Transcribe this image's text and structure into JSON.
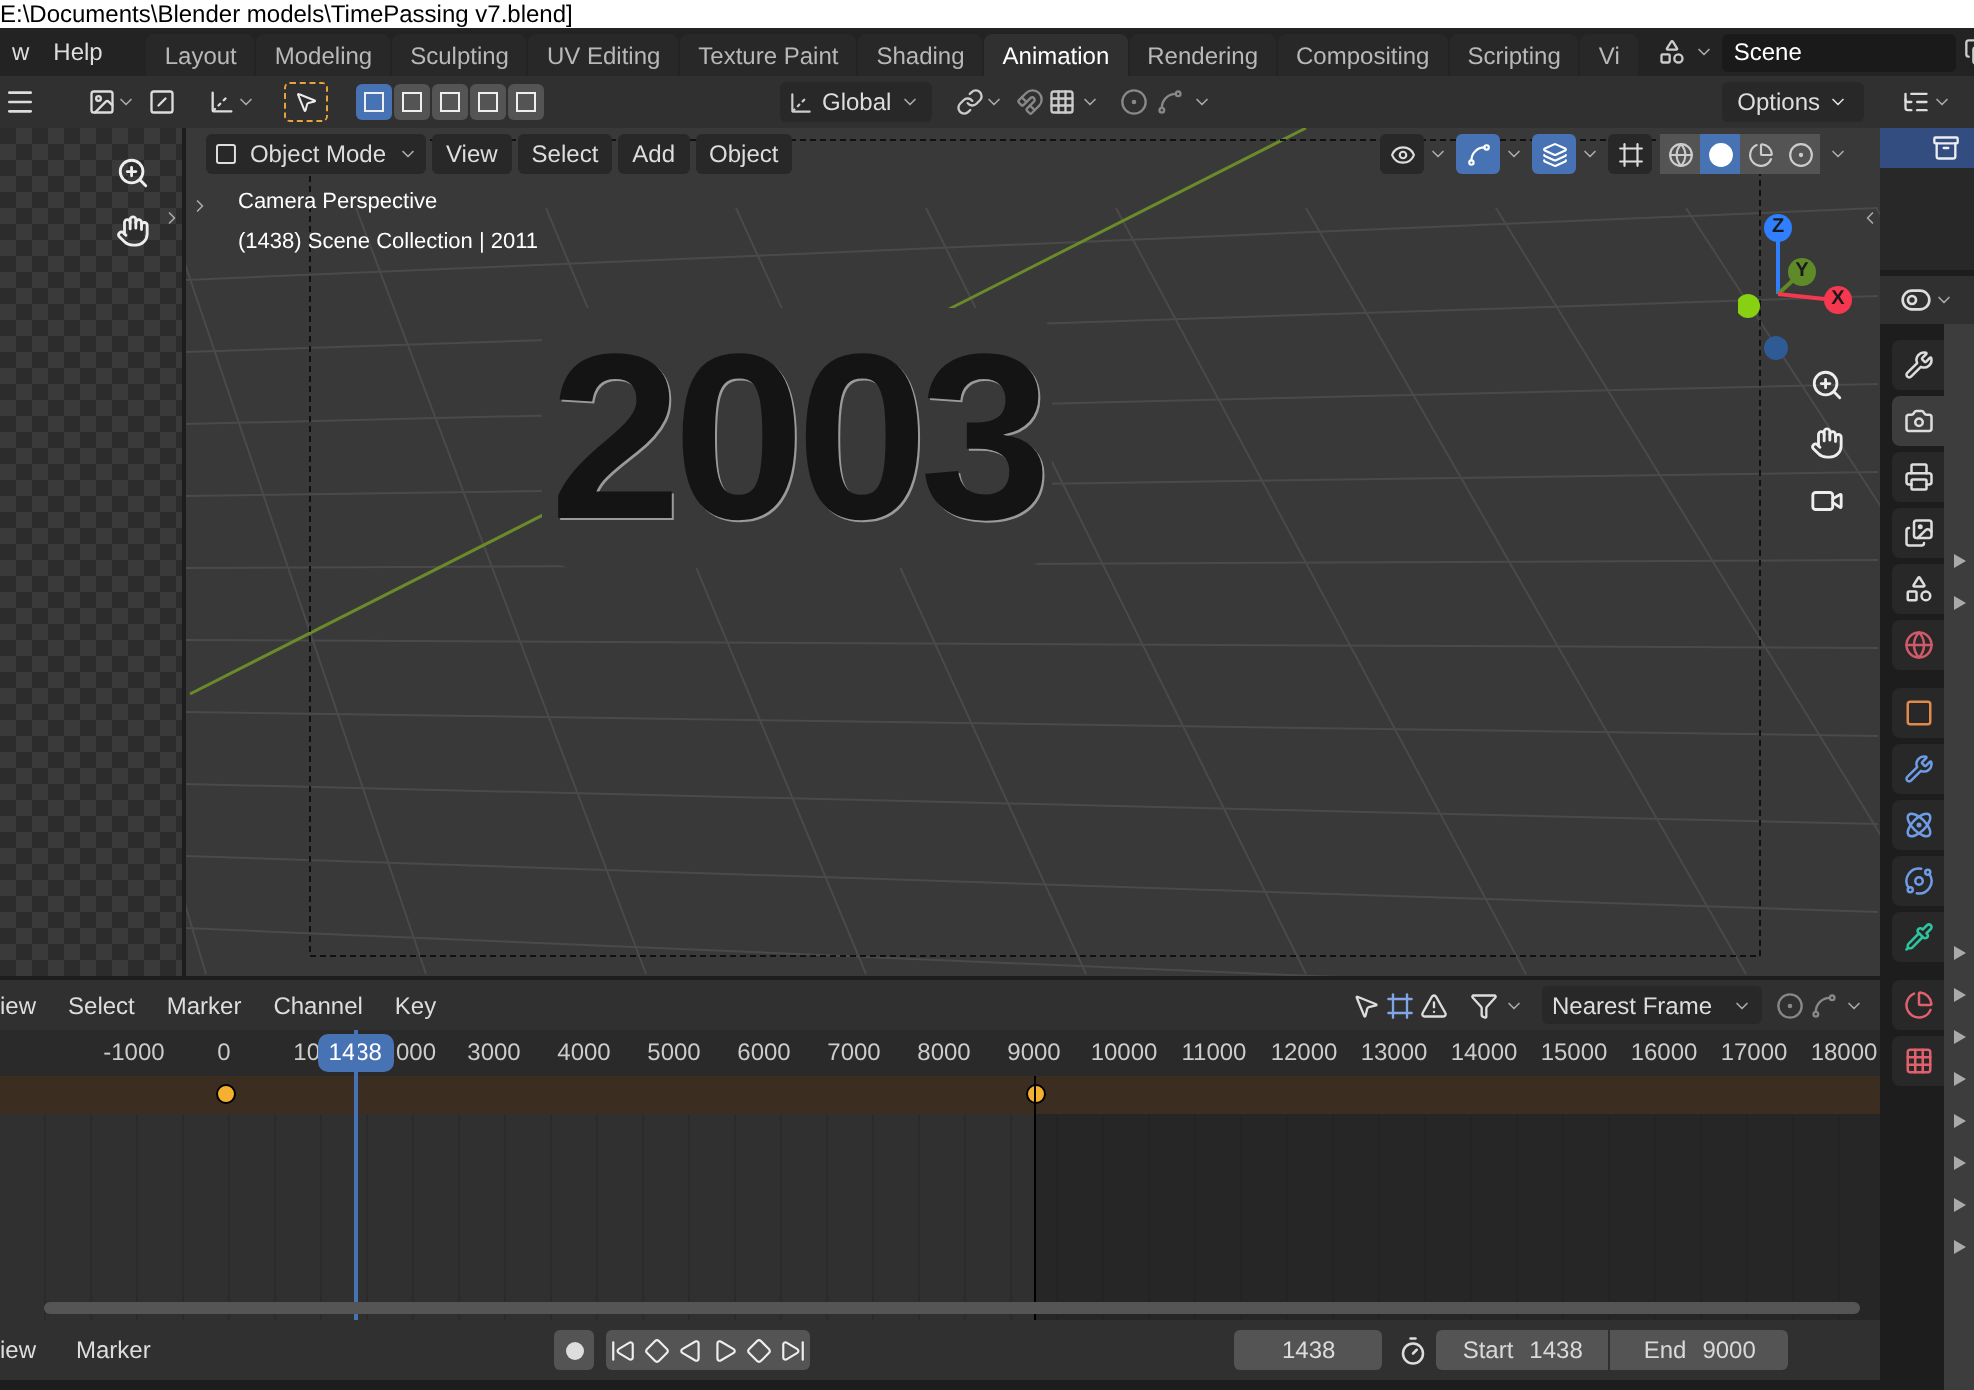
{
  "window": {
    "title": "E:\\Documents\\Blender models\\TimePassing v7.blend]"
  },
  "top_menu": [
    "w",
    "Help"
  ],
  "workspace_tabs": [
    {
      "label": "Layout",
      "selected": false
    },
    {
      "label": "Modeling",
      "selected": false
    },
    {
      "label": "Sculpting",
      "selected": false
    },
    {
      "label": "UV Editing",
      "selected": false
    },
    {
      "label": "Texture Paint",
      "selected": false
    },
    {
      "label": "Shading",
      "selected": false
    },
    {
      "label": "Animation",
      "selected": true
    },
    {
      "label": "Rendering",
      "selected": false
    },
    {
      "label": "Compositing",
      "selected": false
    },
    {
      "label": "Scripting",
      "selected": false
    },
    {
      "label": "Vi",
      "selected": false
    }
  ],
  "scene": {
    "name": "Scene"
  },
  "tool_header": {
    "select_modes": [
      {
        "selected": true
      },
      {
        "selected": false
      },
      {
        "selected": false
      },
      {
        "selected": false
      },
      {
        "selected": false
      }
    ],
    "orientation": "Global",
    "options": "Options"
  },
  "viewport": {
    "mode": "Object Mode",
    "menus": [
      "View",
      "Select",
      "Add",
      "Object"
    ],
    "overlay_lines": [
      "Camera Perspective",
      "(1438) Scene Collection | 2011"
    ],
    "scene_text": "2003",
    "toggles": [
      {
        "kind": "visibility",
        "on": false
      },
      {
        "kind": "gizmo",
        "on": true
      },
      {
        "kind": "overlay",
        "on": true
      },
      {
        "kind": "xray",
        "on": false
      }
    ],
    "shading_modes": [
      {
        "kind": "wireframe",
        "selected": false
      },
      {
        "kind": "solid",
        "selected": true
      },
      {
        "kind": "material",
        "selected": false
      },
      {
        "kind": "rendered",
        "selected": false
      }
    ],
    "gizmo_axes": [
      {
        "label": "Z",
        "color": "#2f7fff"
      },
      {
        "label": "Y",
        "color": "#5f8a28"
      },
      {
        "label": "X",
        "color": "#f5384f"
      }
    ]
  },
  "timeline": {
    "menus": [
      "iew",
      "Select",
      "Marker",
      "Channel",
      "Key"
    ],
    "snap": "Nearest Frame",
    "ruler": [
      {
        "label": "-1000",
        "kind": "full"
      },
      {
        "label": "0",
        "kind": "full"
      },
      {
        "label": "10",
        "kind": "left_part"
      },
      {
        "label": "000",
        "kind": "right_part"
      },
      {
        "label": "3000",
        "kind": "full"
      },
      {
        "label": "4000",
        "kind": "full"
      },
      {
        "label": "5000",
        "kind": "full"
      },
      {
        "label": "6000",
        "kind": "full"
      },
      {
        "label": "7000",
        "kind": "full"
      },
      {
        "label": "8000",
        "kind": "full"
      },
      {
        "label": "9000",
        "kind": "full"
      },
      {
        "label": "10000",
        "kind": "full"
      },
      {
        "label": "11000",
        "kind": "full"
      },
      {
        "label": "12000",
        "kind": "full"
      },
      {
        "label": "13000",
        "kind": "full"
      },
      {
        "label": "14000",
        "kind": "full"
      },
      {
        "label": "15000",
        "kind": "full"
      },
      {
        "label": "16000",
        "kind": "full"
      },
      {
        "label": "17000",
        "kind": "full"
      },
      {
        "label": "18000",
        "kind": "full"
      }
    ],
    "current_frame": "1438",
    "playhead": {
      "level": 0.191
    },
    "keyframes": [
      {
        "selected": true
      },
      {
        "selected": true
      }
    ]
  },
  "playback_bar": {
    "menus": [
      "iew",
      "Marker"
    ],
    "auto_keying": false,
    "current_frame": "1438",
    "start_label": "Start",
    "start": "1438",
    "end_label": "End",
    "end": "9000"
  },
  "properties_tabs": [
    {
      "kind": "tool",
      "selected": false
    },
    {
      "kind": "render",
      "selected": true
    },
    {
      "kind": "output",
      "selected": false
    },
    {
      "kind": "view_layer",
      "selected": false
    },
    {
      "kind": "scene",
      "selected": false
    },
    {
      "kind": "world",
      "selected": false
    },
    {
      "kind": "object",
      "selected": false
    },
    {
      "kind": "modifiers",
      "selected": false
    },
    {
      "kind": "particles",
      "selected": false
    },
    {
      "kind": "physics",
      "selected": false
    },
    {
      "kind": "data",
      "selected": false
    },
    {
      "kind": "material",
      "selected": false
    },
    {
      "kind": "texture",
      "selected": false
    }
  ]
}
